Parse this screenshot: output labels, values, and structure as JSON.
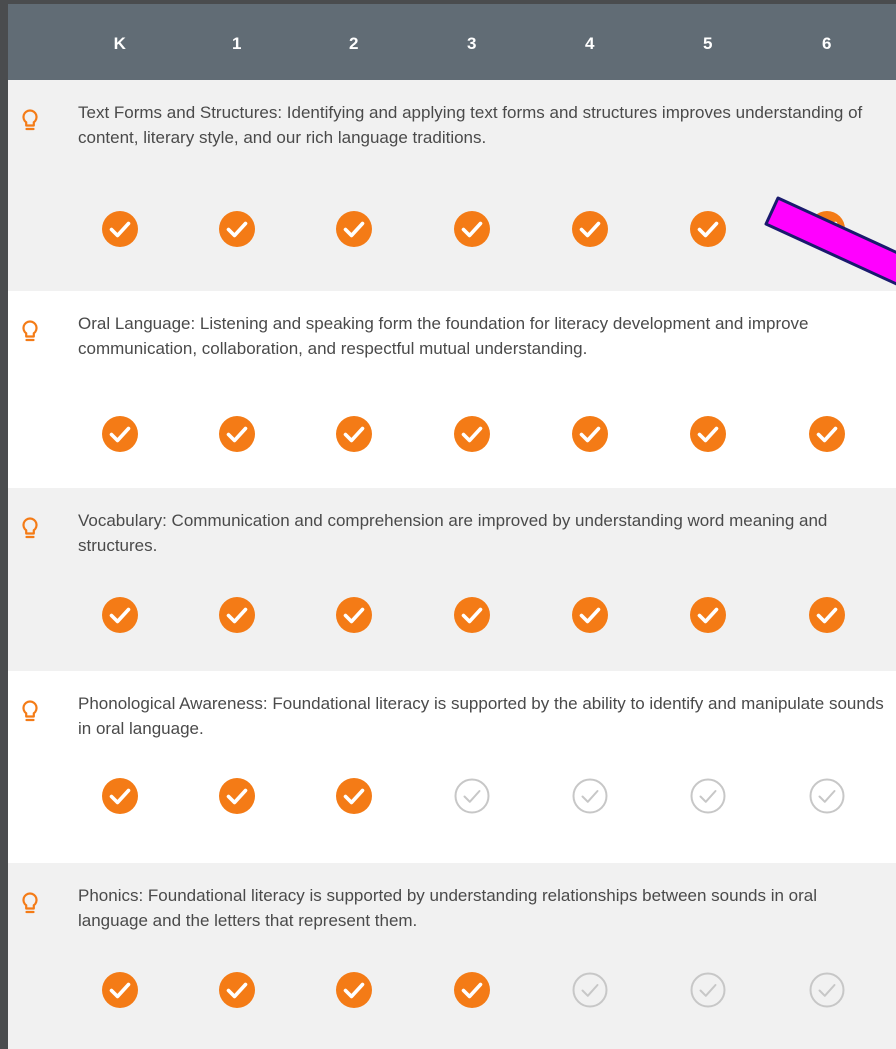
{
  "grades": [
    "K",
    "1",
    "2",
    "3",
    "4",
    "5",
    "6"
  ],
  "colors": {
    "header_bg": "#616c75",
    "accent_orange": "#f47b16",
    "unchecked_grey": "#c7c7c7",
    "row_shaded": "#f1f1f1",
    "row_plain": "#ffffff",
    "annotation_arrow": "#ff00ff"
  },
  "icons": {
    "row_icon": "lightbulb-icon",
    "checked": "check-circle-filled-icon",
    "unchecked": "check-circle-outline-icon"
  },
  "rows": [
    {
      "text": "Text Forms and Structures: Identifying and applying text forms and structures improves understanding of content, literary style, and our rich language traditions.",
      "checks": [
        true,
        true,
        true,
        true,
        true,
        true,
        true
      ]
    },
    {
      "text": "Oral Language: Listening and speaking form the foundation for literacy development and improve communication, collaboration, and respectful mutual understanding.",
      "checks": [
        true,
        true,
        true,
        true,
        true,
        true,
        true
      ]
    },
    {
      "text": "Vocabulary: Communication and comprehension are improved by understanding word meaning and structures.",
      "checks": [
        true,
        true,
        true,
        true,
        true,
        true,
        true
      ]
    },
    {
      "text": "Phonological Awareness: Foundational literacy is supported by the ability to identify and manipulate sounds in oral language.",
      "checks": [
        true,
        true,
        true,
        false,
        false,
        false,
        false
      ]
    },
    {
      "text": "Phonics: Foundational literacy is supported by understanding relationships between sounds in oral language and the letters that represent them.",
      "checks": [
        true,
        true,
        true,
        true,
        false,
        false,
        false
      ]
    }
  ]
}
